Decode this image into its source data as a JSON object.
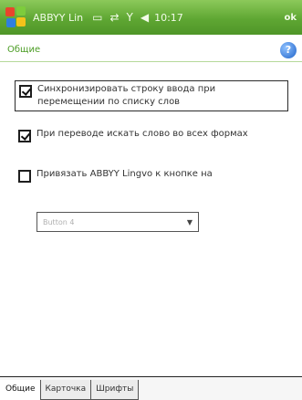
{
  "titlebar": {
    "app_title": "ABBYY Lin",
    "clock": "10:17",
    "ok_label": "ok"
  },
  "header": {
    "title": "Общие"
  },
  "options": [
    {
      "label": "Синхронизировать строку ввода при перемещении по списку слов",
      "checked": true
    },
    {
      "label": "При переводе искать слово во всех формах",
      "checked": true
    },
    {
      "label": "Привязать ABBYY Lingvo к кнопке на",
      "checked": false
    }
  ],
  "dropdown": {
    "value": "Button 4"
  },
  "tabs": [
    {
      "label": "Общие",
      "active": true
    },
    {
      "label": "Карточка",
      "active": false
    },
    {
      "label": "Шрифты",
      "active": false
    }
  ],
  "colors": {
    "title_green": "#5fa733",
    "header_text": "#4c9d25"
  },
  "icons": {
    "start": "windows-flag-icon",
    "help": "help-icon",
    "dropdown": "chevron-down-icon"
  }
}
